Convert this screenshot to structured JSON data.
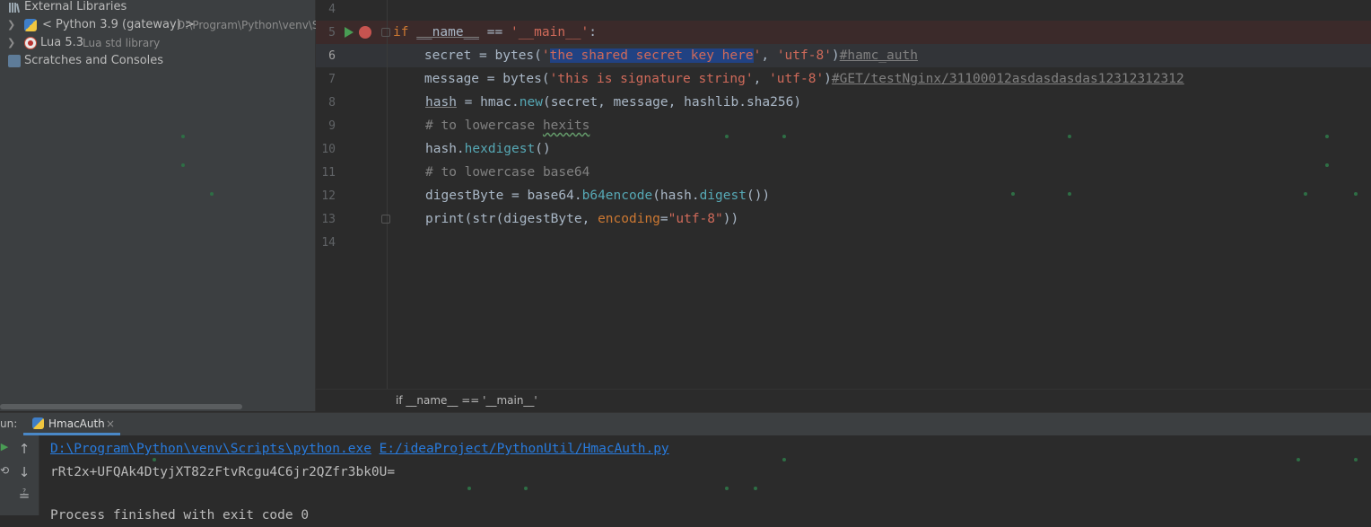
{
  "sidebar": {
    "items": [
      {
        "label": "External Libraries",
        "sub": ""
      },
      {
        "label": "< Python 3.9 (gateway) >",
        "sub": "D:\\Program\\Python\\venv\\S"
      },
      {
        "label": "Lua 5.3",
        "sub": "Lua std library"
      },
      {
        "label": "Scratches and Consoles",
        "sub": ""
      }
    ]
  },
  "editor": {
    "line_numbers": [
      "4",
      "5",
      "6",
      "7",
      "8",
      "9",
      "10",
      "11",
      "12",
      "13",
      "14"
    ],
    "lines": {
      "l5": {
        "kw": "if",
        "sp1": " ",
        "name": "__name__",
        "op": " == ",
        "str": "'__main__'",
        "colon": ":"
      },
      "l6": {
        "a": "    secret = ",
        "fn": "bytes",
        "p1": "(",
        "q1": "'",
        "sel": "the shared secret key here",
        "q2": "'",
        "comma": ", ",
        "enc": "'utf-8'",
        "p2": ")",
        "cm": "#hamc_auth"
      },
      "l7": {
        "a": "    message = ",
        "fn": "bytes",
        "p1": "(",
        "s": "'this is signature string'",
        "comma": ", ",
        "enc": "'utf-8'",
        "p2": ")",
        "cm": "#GET/testNginx/31100012asdasdasdas12312312312"
      },
      "l8": {
        "name": "hash",
        "a": " = hmac.",
        "fn": "new",
        "b": "(secret, message, hashlib.sha256)"
      },
      "l9": {
        "cm": "# to lowercase ",
        "typo": "hexits"
      },
      "l10": {
        "a": "hash.",
        "fn": "hexdigest",
        "b": "()"
      },
      "l11": {
        "cm": "# to lowercase base64"
      },
      "l12": {
        "a": "digestByte = base64.",
        "fn": "b64encode",
        "b": "(hash.",
        "fn2": "digest",
        "c": "())"
      },
      "l13": {
        "fn": "print",
        "a": "(str(digestByte, ",
        "kw": "encoding",
        "eq": "=",
        "s": "\"utf-8\"",
        "b": "))"
      }
    },
    "breadcrumb": "if __name__ == '__main__'",
    "colors": {
      "keyword": "#cc7832",
      "string": "#6a8759",
      "comment": "#808080",
      "breakpoint": "#c75450",
      "selection": "#214283"
    }
  },
  "run_panel": {
    "label": "un:",
    "tab_label": "HmacAuth",
    "tab_close": "×",
    "toolbar_icons": [
      "run-icon",
      "arrow-up-icon",
      "wrench-icon",
      "arrow-down-icon",
      "soft-wrap-icon"
    ],
    "console": {
      "interpreter": "D:\\Program\\Python\\venv\\Scripts\\python.exe",
      "script": "E:/ideaProject/PythonUtil/HmacAuth.py",
      "output": "rRt2x+UFQAk4DtyjXT82zFtvRcgu4C6jr2QZfr3bk0U=",
      "exit_line": "Process finished with exit code 0"
    }
  }
}
